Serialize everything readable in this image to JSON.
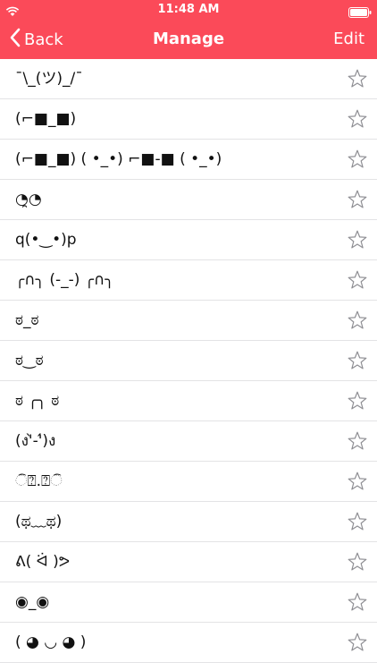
{
  "status_bar": {
    "time": "11:48 AM"
  },
  "nav": {
    "back_label": "Back",
    "title": "Manage",
    "edit_label": "Edit"
  },
  "colors": {
    "accent": "#fb4a59",
    "separator": "#e3e3e5",
    "star": "#8e8e93"
  },
  "items": [
    {
      "text": "¯\\_(ツ)_/¯"
    },
    {
      "text": "(⌐■_■)"
    },
    {
      "text": "(⌐■_■) ( •_•) ⌐■-■ ( •_•)"
    },
    {
      "text": "◔̯◔"
    },
    {
      "text": "q(•‿•)p"
    },
    {
      "text": "╭∩╮ (-_-) ╭∩╮"
    },
    {
      "text": "ಠ_ಠ"
    },
    {
      "text": "ಠ‿ಠ"
    },
    {
      "text": "ಠ ╭╮ ಠ"
    },
    {
      "text": "(ง'̀-'́)ง"
    },
    {
      "text": "ି⍰.⍰ି"
    },
    {
      "text": "(ಥ﹏ಥ)"
    },
    {
      "text": "ᕕ( ᐛ )ᕗ"
    },
    {
      "text": "◉_◉"
    },
    {
      "text": "( ◕ ◡ ◕ )"
    }
  ]
}
